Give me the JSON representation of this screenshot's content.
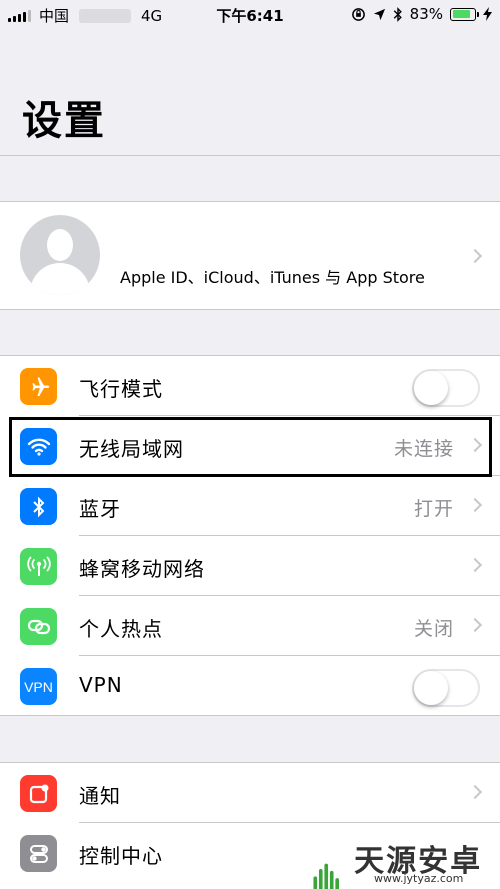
{
  "status_bar": {
    "carrier": "中国",
    "network": "4G",
    "time": "下午6:41",
    "battery_percent": "83%",
    "battery_level": 0.83
  },
  "page": {
    "title": "设置"
  },
  "profile": {
    "subtitle": "Apple ID、iCloud、iTunes 与 App Store"
  },
  "group1": [
    {
      "label": "飞行模式",
      "icon": "airplane-icon",
      "color": "#ff9500",
      "toggle": false
    },
    {
      "label": "无线局域网",
      "icon": "wifi-icon",
      "color": "#007aff",
      "value": "未连接"
    },
    {
      "label": "蓝牙",
      "icon": "bluetooth-icon",
      "color": "#007aff",
      "value": "打开"
    },
    {
      "label": "蜂窝移动网络",
      "icon": "antenna-icon",
      "color": "#4cd964",
      "value": ""
    },
    {
      "label": "个人热点",
      "icon": "hotspot-icon",
      "color": "#4cd964",
      "value": "关闭"
    },
    {
      "label": "VPN",
      "icon": "vpn-icon",
      "color": "#0a84ff",
      "toggle": false,
      "icon_text": "VPN"
    }
  ],
  "group2": [
    {
      "label": "通知",
      "icon": "notifications-icon",
      "color": "#ff3b30"
    },
    {
      "label": "控制中心",
      "icon": "control-center-icon",
      "color": "#8e8e93"
    }
  ],
  "watermark": {
    "text": "天源安卓网",
    "url": "www.jytyaz.com"
  }
}
